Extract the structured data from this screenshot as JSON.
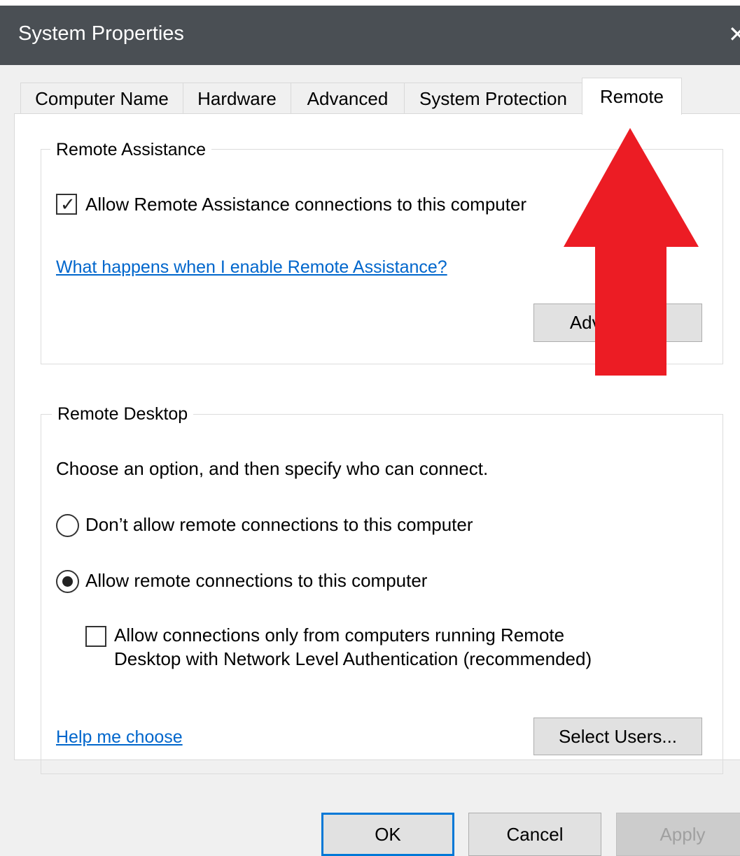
{
  "window": {
    "title": "System Properties",
    "close_icon": "close-icon"
  },
  "tabs": [
    {
      "label": "Computer Name",
      "selected": false
    },
    {
      "label": "Hardware",
      "selected": false
    },
    {
      "label": "Advanced",
      "selected": false
    },
    {
      "label": "System Protection",
      "selected": false
    },
    {
      "label": "Remote",
      "selected": true
    }
  ],
  "remote_assistance": {
    "group_title": "Remote Assistance",
    "allow_checkbox_label": "Allow Remote Assistance connections to this computer",
    "allow_checked": true,
    "help_link": "What happens when I enable Remote Assistance?",
    "advanced_button": "Advanced..."
  },
  "remote_desktop": {
    "group_title": "Remote Desktop",
    "instructions": "Choose an option, and then specify who can connect.",
    "options": [
      {
        "label": "Don’t allow remote connections to this computer",
        "selected": false
      },
      {
        "label": "Allow remote connections to this computer",
        "selected": true
      }
    ],
    "nla_label_line1": "Allow connections only from computers running Remote",
    "nla_label_line2": "Desktop with Network Level Authentication (recommended)",
    "nla_checked": false,
    "help_link": "Help me choose",
    "select_users_button": "Select Users..."
  },
  "footer": {
    "ok_label": "OK",
    "cancel_label": "Cancel",
    "apply_label": "Apply",
    "apply_enabled": false
  },
  "annotation": {
    "arrow_color": "#ec1c24",
    "arrow_icon": "up-arrow-icon"
  },
  "colors": {
    "titlebar": "#4a4f54",
    "link": "#0066cc",
    "default_button_border": "#0078d7"
  }
}
